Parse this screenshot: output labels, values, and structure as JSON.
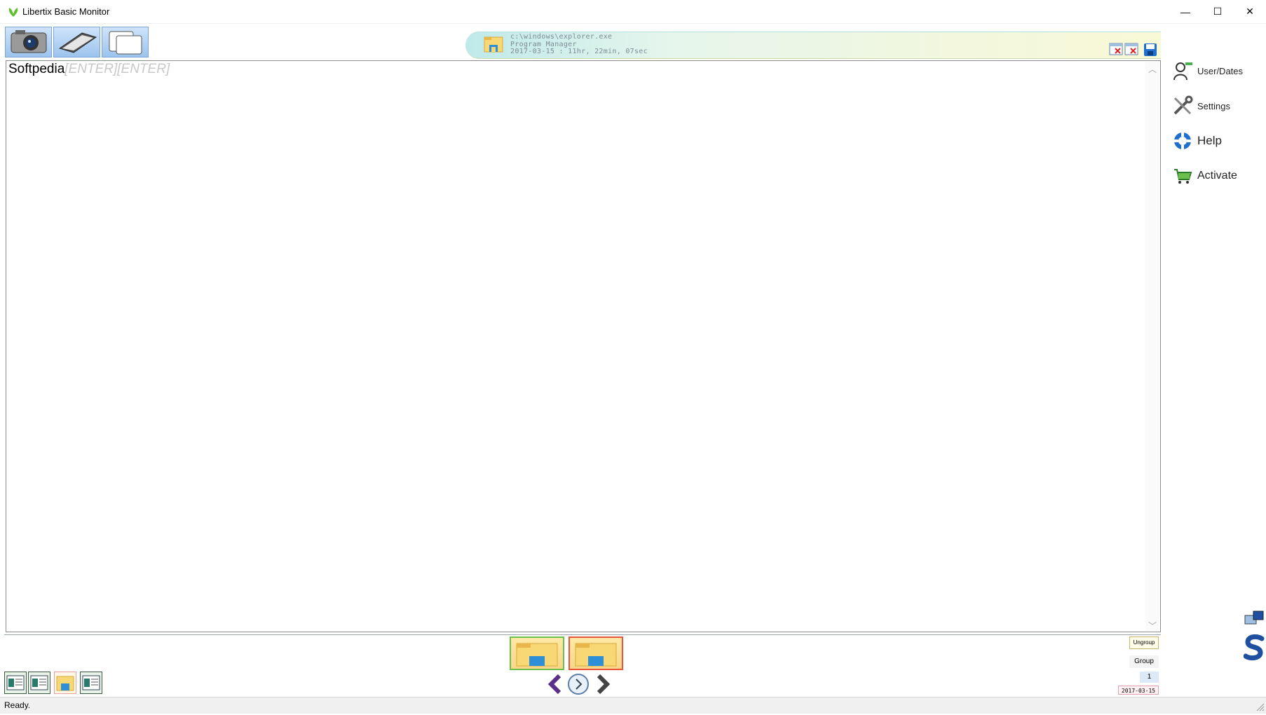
{
  "window": {
    "title": "Libertix Basic Monitor",
    "minimize_glyph": "—",
    "maximize_glyph": "☐",
    "close_glyph": "✕"
  },
  "toolbar": {
    "buttons": [
      "camera-icon",
      "keyboard-icon",
      "clipboard-icon"
    ]
  },
  "banner": {
    "path": "c:\\windows\\explorer.exe",
    "window_name": "Program Manager",
    "timestamp": "2017-03-15 : 11hr, 22min, 07sec"
  },
  "editor": {
    "typed_text": "Softpedia",
    "keys_text": "[ENTER][ENTER]"
  },
  "sidebar": {
    "items": [
      {
        "label": "User/Dates",
        "icon": "user-dates-icon"
      },
      {
        "label": "Settings",
        "icon": "tools-icon"
      },
      {
        "label": "Help",
        "icon": "lifebuoy-icon"
      },
      {
        "label": "Activate",
        "icon": "cart-icon"
      }
    ]
  },
  "bottom": {
    "ungroup_label": "Ungroup",
    "group_label": "Group",
    "page_number": "1",
    "date_label": "2017-03-15"
  },
  "status": {
    "text": "Ready."
  },
  "colors": {
    "accent": "#7aa7d6",
    "nav_purple": "#5b2e8a",
    "thumb_green": "#6cbf4a",
    "thumb_red": "#e8553a"
  }
}
